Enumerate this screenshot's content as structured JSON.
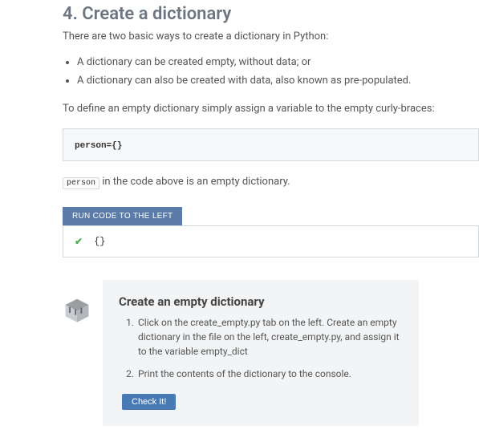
{
  "heading": "4. Create a dictionary",
  "intro": "There are two basic ways to create a dictionary in Python:",
  "bullets": [
    "A dictionary can be created empty, without data; or",
    "A dictionary can also be created with data, also known as pre-populated."
  ],
  "define_text": "To define an empty dictionary simply assign a variable to the empty curly-braces:",
  "code_block": "person={}",
  "inline_code": "person",
  "inline_text_suffix": " in the code above is an empty dictionary.",
  "run_button": "RUN CODE TO THE LEFT",
  "output_check": "✔",
  "output_text": "{}",
  "task": {
    "title": "Create an empty dictionary",
    "steps": [
      "Click on the create_empty.py tab on the left. Create an empty dictionary in the file on the left, create_empty.py, and assign it to the variable empty_dict",
      "Print the contents of the dictionary to the console."
    ],
    "check_button": "Check It!"
  }
}
